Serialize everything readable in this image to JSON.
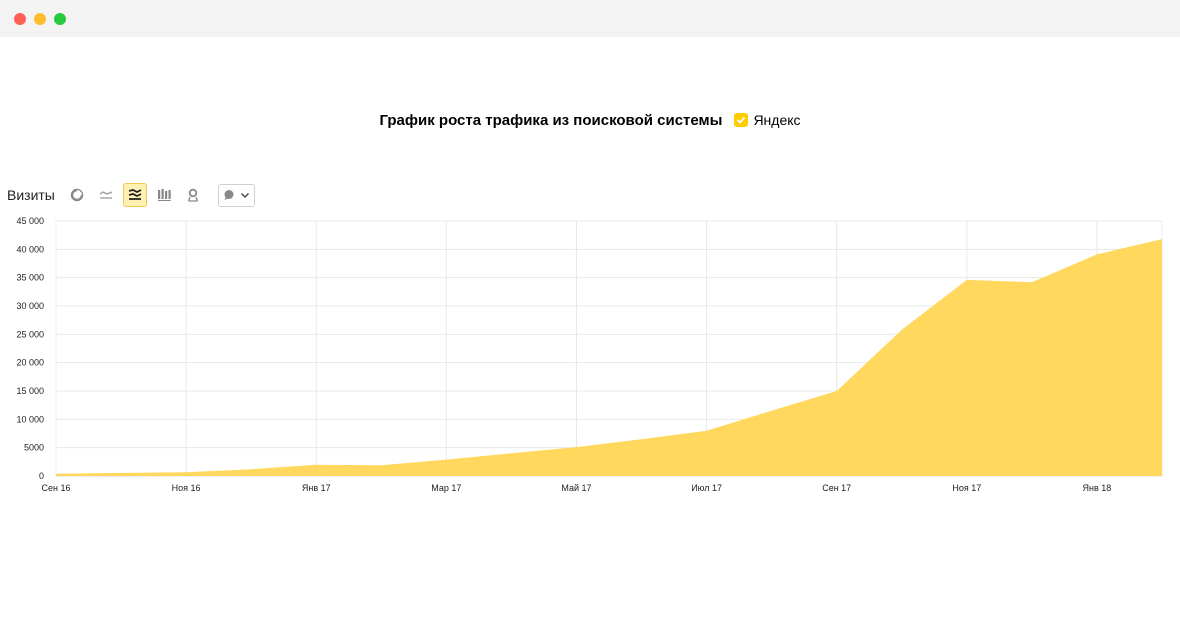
{
  "header": {
    "title": "График роста трафика из поисковой системы"
  },
  "legend": {
    "label": "Яндекс",
    "color": "#ffcc00"
  },
  "toolbar": {
    "metric": "Визиты",
    "icons": [
      "pie-chart-icon",
      "line-chart-icon",
      "area-chart-icon",
      "bar-chart-icon",
      "map-pin-icon",
      "comment-icon",
      "chevron-down-icon"
    ],
    "active": "area-chart-icon"
  },
  "chart_data": {
    "type": "area",
    "title": "График роста трафика из поисковой системы",
    "ylabel": "Визиты",
    "xlabel": "",
    "ylim": [
      0,
      45000
    ],
    "y_ticks": [
      0,
      5000,
      10000,
      15000,
      20000,
      25000,
      30000,
      35000,
      40000,
      45000
    ],
    "y_tick_labels": [
      "0",
      "5000",
      "10 000",
      "15 000",
      "20 000",
      "25 000",
      "30 000",
      "35 000",
      "40 000",
      "45 000"
    ],
    "x_tick_labels": [
      "Сен 16",
      "Ноя 16",
      "Янв 17",
      "Мар 17",
      "Май 17",
      "Июл 17",
      "Сен 17",
      "Ноя 17",
      "Янв 18"
    ],
    "x": [
      "Сен 16",
      "Окт 16",
      "Ноя 16",
      "Дек 16",
      "Янв 17",
      "Фев 17",
      "Мар 17",
      "Апр 17",
      "Май 17",
      "Июн 17",
      "Июл 17",
      "Авг 17",
      "Сен 17",
      "Окт 17",
      "Ноя 17",
      "Дек 17",
      "Янв 18",
      "Фев 18"
    ],
    "series": [
      {
        "name": "Яндекс",
        "color": "#ffd54f",
        "values": [
          400,
          550,
          650,
          1200,
          2000,
          1900,
          2900,
          4000,
          5100,
          6500,
          8000,
          11500,
          15000,
          25800,
          34600,
          34200,
          39100,
          41800
        ]
      }
    ],
    "grid": true,
    "legend_position": "top"
  }
}
